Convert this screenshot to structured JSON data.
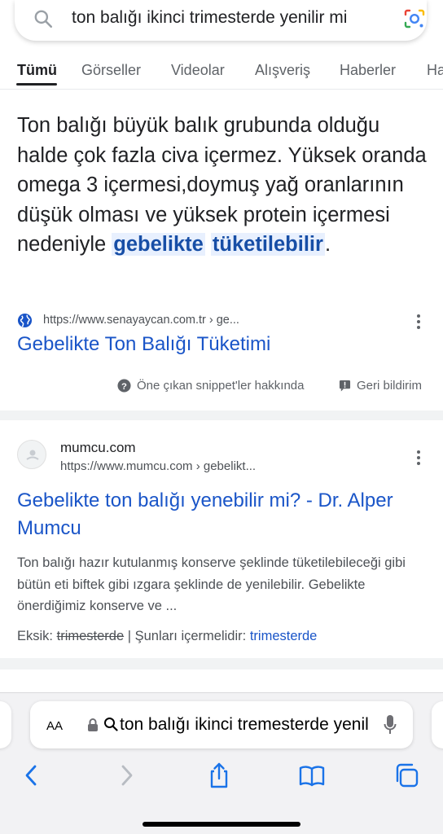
{
  "search": {
    "query": "ton balığı ikinci trimesterde yenilir mi",
    "icons": [
      "search-icon",
      "google-lens-icon"
    ]
  },
  "tabs": [
    {
      "label": "Tümü",
      "active": true
    },
    {
      "label": "Görseller"
    },
    {
      "label": "Videolar"
    },
    {
      "label": "Alışveriş"
    },
    {
      "label": "Haberler"
    },
    {
      "label": "Ha"
    }
  ],
  "featured_snippet": {
    "text_plain": "Ton balığı büyük balık grubunda olduğu halde çok fazla civa içermez. Yüksek oranda omega 3 içermesi,doymuş yağ oranlarının düşük olması ve yüksek protein içermesi nedeniyle ",
    "highlight_line1": "gebelikte",
    "highlight_line2": "tüketilebilir",
    "text_end": ".",
    "source_url": "https://www.senayaycan.com.tr › ge...",
    "title": "Gebelikte Ton Balığı Tüketimi",
    "about_label": "Öne çıkan snippet'ler hakkında",
    "feedback_label": "Geri bildirim"
  },
  "result2": {
    "site_name": "mumcu.com",
    "url": "https://www.mumcu.com › gebelikt...",
    "title": "Gebelikte ton balığı yenebilir mi? - Dr. Alper Mumcu",
    "description": "Ton balığı hazır kutulanmış konserve şeklinde tüketilebileceği gibi bütün eti biftek gibi ızgara şeklinde de yenilebilir. Gebelikte önerdiğimiz konserve ve ...",
    "missing_label": "Eksik:",
    "missing_term": "trimesterde",
    "must_include_label": "| Şunları içermelidir:",
    "must_include_term": "trimesterde"
  },
  "safari": {
    "aa_label": "AA",
    "address_text": "ton balığı ikinci tremesterde yenilir mi",
    "toolbar_icons": [
      "back-icon",
      "forward-icon",
      "share-icon",
      "bookmarks-icon",
      "tabs-icon"
    ]
  },
  "colors": {
    "link": "#1a55c8",
    "highlight_bg": "#e8f0fe",
    "highlight_text": "#174ea6",
    "safari_blue": "#1a73e8"
  }
}
